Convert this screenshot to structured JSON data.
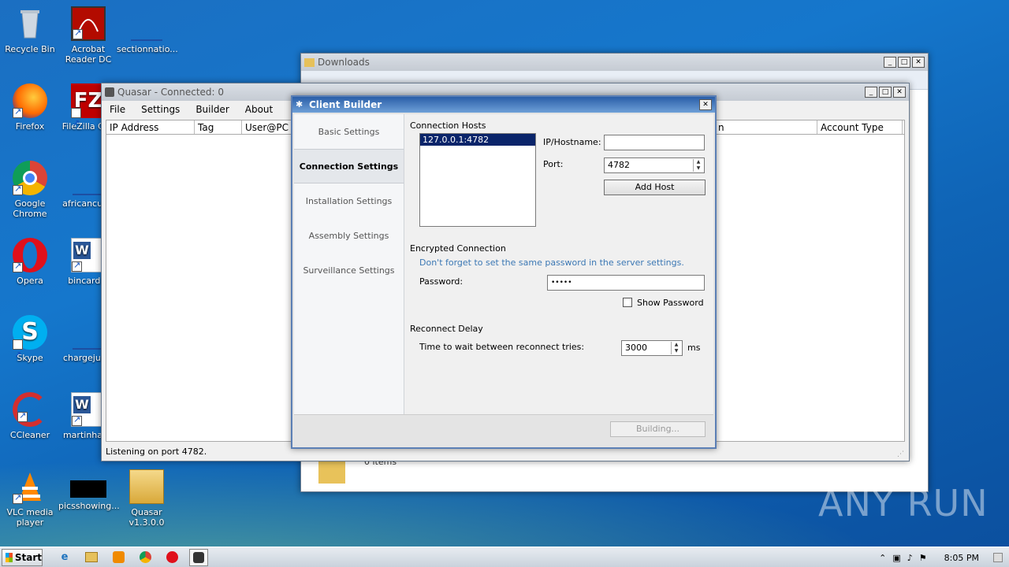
{
  "desktop": {
    "icons": [
      {
        "label": "Recycle Bin",
        "icon": "recycle-bin-icon"
      },
      {
        "label": "Acrobat Reader DC",
        "icon": "acrobat-icon"
      },
      {
        "label": "sectionnatio...",
        "icon": "file-icon"
      },
      {
        "label": "Firefox",
        "icon": "firefox-icon"
      },
      {
        "label": "FileZilla Cl...",
        "icon": "filezilla-icon"
      },
      {
        "label": "Google Chrome",
        "icon": "chrome-icon"
      },
      {
        "label": "africancut...",
        "icon": "file-icon"
      },
      {
        "label": "Opera",
        "icon": "opera-icon"
      },
      {
        "label": "bincard...",
        "icon": "word-icon"
      },
      {
        "label": "Skype",
        "icon": "skype-icon"
      },
      {
        "label": "chargejus...",
        "icon": "file-icon"
      },
      {
        "label": "CCleaner",
        "icon": "ccleaner-icon"
      },
      {
        "label": "martinhar...",
        "icon": "word-icon"
      },
      {
        "label": "VLC media player",
        "icon": "vlc-icon"
      },
      {
        "label": "picsshowing...",
        "icon": "image-icon"
      },
      {
        "label": "Quasar v1.3.0.0",
        "icon": "quasar-folder-icon"
      }
    ]
  },
  "downloads": {
    "title": "Downloads",
    "items_text": "0 items"
  },
  "quasar": {
    "title": "Quasar - Connected: 0",
    "menu": [
      "File",
      "Settings",
      "Builder",
      "About"
    ],
    "columns": [
      "IP Address",
      "Tag",
      "User@PC",
      "n",
      "Account Type"
    ],
    "status": "Listening on port 4782."
  },
  "builder": {
    "title": "Client Builder",
    "nav": [
      "Basic Settings",
      "Connection Settings",
      "Installation Settings",
      "Assembly Settings",
      "Surveillance Settings"
    ],
    "active_nav": "Connection Settings",
    "connection_hosts_label": "Connection Hosts",
    "hosts": [
      "127.0.0.1:4782"
    ],
    "ip_label": "IP/Hostname:",
    "ip_value": "",
    "port_label": "Port:",
    "port_value": "4782",
    "add_host": "Add Host",
    "encrypted_label": "Encrypted Connection",
    "encrypted_hint": "Don't forget to set the same password in the server settings.",
    "password_label": "Password:",
    "password_value": "•••••",
    "show_password": "Show Password",
    "reconnect_label": "Reconnect Delay",
    "reconnect_text": "Time to wait between reconnect tries:",
    "reconnect_value": "3000",
    "reconnect_unit": "ms",
    "building": "Building..."
  },
  "taskbar": {
    "start": "Start",
    "time": "8:05 PM"
  },
  "watermark": "ANY RUN"
}
